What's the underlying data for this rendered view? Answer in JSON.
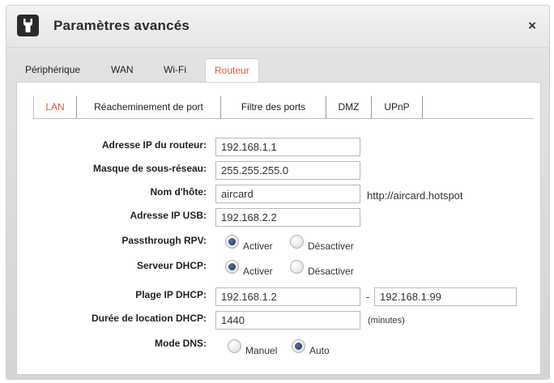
{
  "window": {
    "title": "Paramètres avancés",
    "close_label": "×"
  },
  "main_tabs": [
    {
      "label": "Périphérique"
    },
    {
      "label": "WAN"
    },
    {
      "label": "Wi-Fi"
    },
    {
      "label": "Routeur",
      "active": true
    }
  ],
  "sub_tabs": [
    {
      "label": "LAN",
      "active": true
    },
    {
      "label": "Réacheminement de port"
    },
    {
      "label": "Filtre des ports"
    },
    {
      "label": "DMZ"
    },
    {
      "label": "UPnP"
    }
  ],
  "form": {
    "router_ip": {
      "label": "Adresse IP du routeur:",
      "value": "192.168.1.1"
    },
    "subnet_mask": {
      "label": "Masque de sous-réseau:",
      "value": "255.255.255.0"
    },
    "hostname": {
      "label": "Nom d'hôte:",
      "value": "aircard",
      "hint": "http://aircard.hotspot"
    },
    "usb_ip": {
      "label": "Adresse IP USB:",
      "value": "192.168.2.2"
    },
    "vpn_passthrough": {
      "label": "Passthrough RPV:",
      "option_on": "Activer",
      "option_off": "Désactiver",
      "selected": "Activer"
    },
    "dhcp_server": {
      "label": "Serveur DHCP:",
      "option_on": "Activer",
      "option_off": "Désactiver",
      "selected": "Activer"
    },
    "dhcp_range": {
      "label": "Plage IP DHCP:",
      "start": "192.168.1.2",
      "separator": "-",
      "end": "192.168.1.99"
    },
    "dhcp_lease": {
      "label": "Durée de location DHCP:",
      "value": "1440",
      "unit": "(minutes)"
    },
    "dns_mode": {
      "label": "Mode DNS:",
      "option_manual": "Manuel",
      "option_auto": "Auto",
      "selected": "Auto"
    }
  },
  "icons": {
    "app": "wrench-icon",
    "close": "close-icon"
  }
}
